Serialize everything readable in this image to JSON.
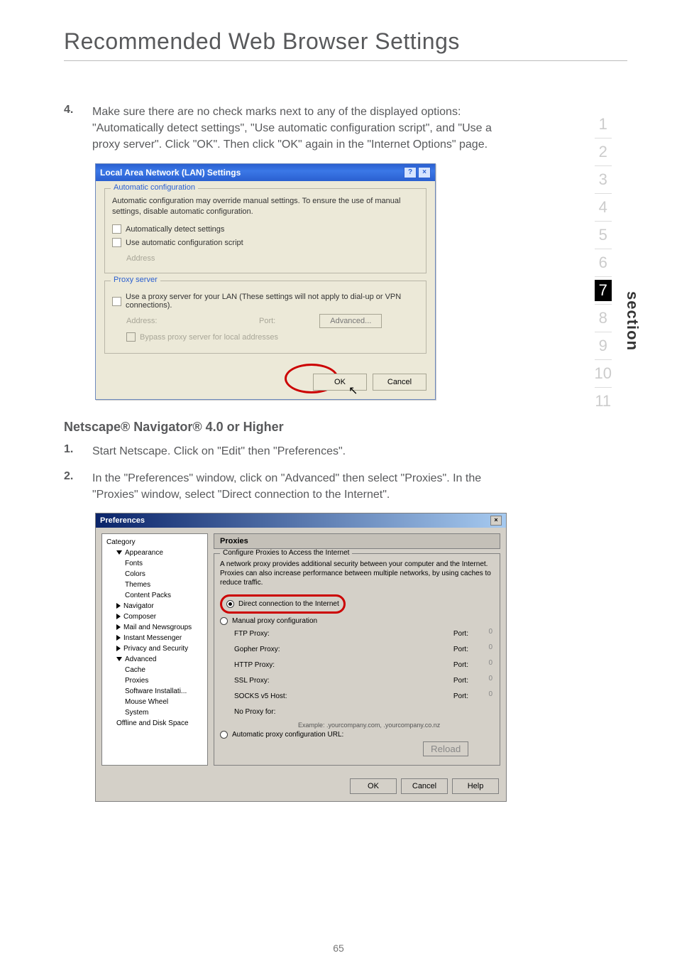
{
  "page": {
    "title": "Recommended Web Browser Settings",
    "number": "65"
  },
  "side": {
    "items": [
      "1",
      "2",
      "3",
      "4",
      "5",
      "6",
      "7",
      "8",
      "9",
      "10",
      "11"
    ],
    "active_index": 6,
    "label": "section"
  },
  "steps_a": {
    "num": "4.",
    "body": "Make sure there are no check marks next to any of the displayed options: \"Automatically detect settings\", \"Use automatic configuration script\", and \"Use a proxy server\". Click \"OK\". Then click \"OK\" again in the \"Internet Options\" page."
  },
  "lan_dialog": {
    "title": "Local Area Network (LAN) Settings",
    "help_btn": "?",
    "close_btn": "×",
    "group1_title": "Automatic configuration",
    "group1_desc": "Automatic configuration may override manual settings.  To ensure the use of manual settings, disable automatic configuration.",
    "check1": "Automatically detect settings",
    "check2": "Use automatic configuration script",
    "addr_label": "Address",
    "group2_title": "Proxy server",
    "proxy_check": "Use a proxy server for your LAN (These settings will not apply to dial-up or VPN connections).",
    "addr2_label": "Address:",
    "port_label": "Port:",
    "advanced_btn": "Advanced...",
    "bypass_check": "Bypass proxy server for local addresses",
    "ok_btn": "OK",
    "cancel_btn": "Cancel"
  },
  "netscape_heading": "Netscape® Navigator® 4.0 or Higher",
  "steps_b": [
    {
      "num": "1.",
      "body": "Start Netscape. Click on \"Edit\" then \"Preferences\"."
    },
    {
      "num": "2.",
      "body": "In the \"Preferences\" window, click on \"Advanced\" then select \"Proxies\". In the \"Proxies\" window, select \"Direct connection to the Internet\"."
    }
  ],
  "prefs": {
    "title": "Preferences",
    "close_btn": "×",
    "cat_header": "Category",
    "categories": {
      "appearance": "Appearance",
      "fonts": "Fonts",
      "colors": "Colors",
      "themes": "Themes",
      "content_packs": "Content Packs",
      "navigator": "Navigator",
      "composer": "Composer",
      "mail_news": "Mail and Newsgroups",
      "instant_msg": "Instant Messenger",
      "privacy": "Privacy and Security",
      "advanced": "Advanced",
      "cache": "Cache",
      "proxies": "Proxies",
      "software": "Software Installati...",
      "mouse": "Mouse Wheel",
      "system": "System",
      "offline": "Offline and Disk Space"
    },
    "panel_title": "Proxies",
    "group_title": "Configure Proxies to Access the Internet",
    "desc": "A network proxy provides additional security between your computer and the Internet. Proxies can also increase performance between multiple networks, by using caches to reduce traffic.",
    "radio_direct": "Direct connection to the Internet",
    "radio_manual": "Manual proxy configuration",
    "ftp_label": "FTP Proxy:",
    "gopher_label": "Gopher Proxy:",
    "http_label": "HTTP Proxy:",
    "ssl_label": "SSL Proxy:",
    "socks_label": "SOCKS v5 Host:",
    "port_label": "Port:",
    "port_val": "0",
    "noproxy_label": "No Proxy for:",
    "example": "Example: .yourcompany.com, .yourcompany.co.nz",
    "radio_auto": "Automatic proxy configuration URL:",
    "reload_btn": "Reload",
    "ok_btn": "OK",
    "cancel_btn": "Cancel",
    "help_btn": "Help"
  }
}
